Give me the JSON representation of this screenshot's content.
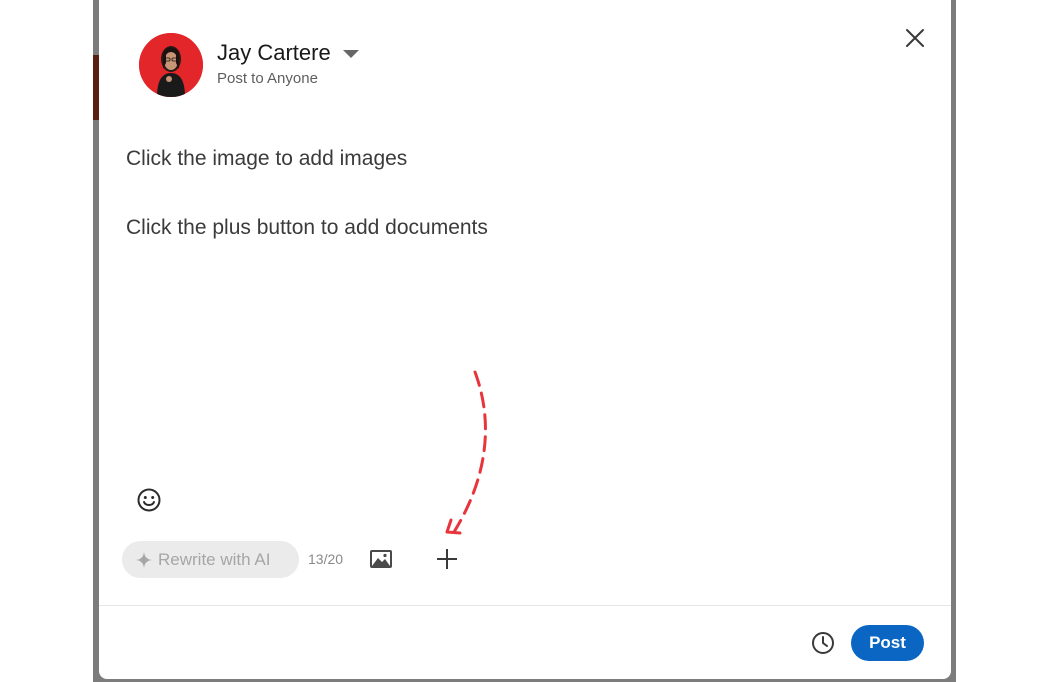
{
  "composer": {
    "author_name": "Jay Cartere",
    "audience": "Post to Anyone",
    "body_lines": [
      "Click the image to add images",
      "Click the plus button to add documents"
    ],
    "rewrite_label": "Rewrite with AI",
    "char_counter": "13/20",
    "post_label": "Post"
  },
  "icons": {
    "close": "close-icon",
    "dropdown": "caret-down-icon",
    "emoji": "smiley-icon",
    "sparkle": "sparkle-icon",
    "image": "image-icon",
    "plus": "plus-icon",
    "schedule": "clock-icon",
    "annotation": "dashed-arrow-icon"
  },
  "colors": {
    "primary": "#0a66c2",
    "annotation": "#e8343b",
    "avatar_bg": "#e3262a"
  }
}
